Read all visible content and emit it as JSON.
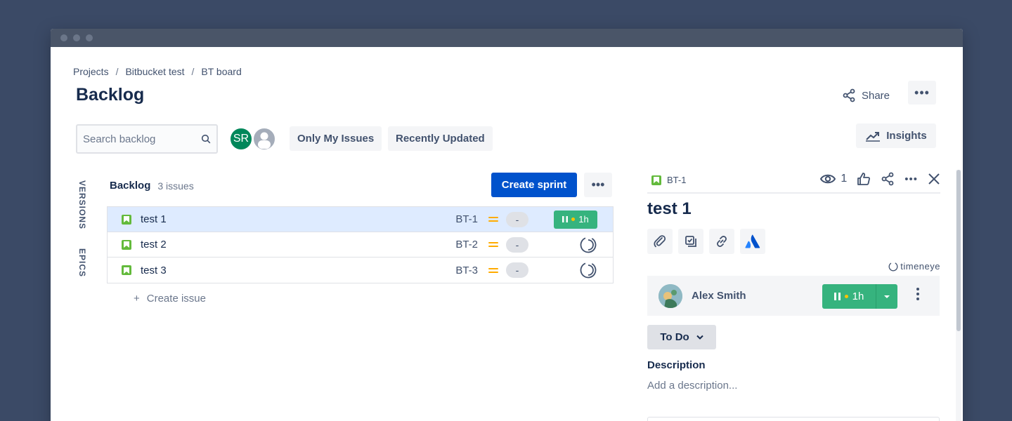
{
  "breadcrumb": {
    "projects": "Projects",
    "project": "Bitbucket test",
    "board": "BT board",
    "sep": "/"
  },
  "page": {
    "title": "Backlog",
    "share_label": "Share",
    "more": "•••"
  },
  "filters": {
    "search_placeholder": "Search backlog",
    "avatar_initials": "SR",
    "only_my_issues": "Only My Issues",
    "recently_updated": "Recently Updated",
    "insights": "Insights"
  },
  "side_tabs": {
    "versions": "VERSIONS",
    "epics": "EPICS"
  },
  "backlog": {
    "title": "Backlog",
    "count": "3 issues",
    "create_sprint": "Create sprint",
    "more": "•••",
    "create_issue": "Create issue",
    "plus": "+",
    "issues": [
      {
        "summary": "test 1",
        "key": "BT-1",
        "estimate": "-",
        "timer": "1h"
      },
      {
        "summary": "test 2",
        "key": "BT-2",
        "estimate": "-"
      },
      {
        "summary": "test 3",
        "key": "BT-3",
        "estimate": "-"
      }
    ]
  },
  "detail": {
    "key": "BT-1",
    "watchers": "1",
    "title": "test 1",
    "brand": "timeneye",
    "user_name": "Alex Smith",
    "timer": "1h",
    "status": "To Do",
    "description_label": "Description",
    "description_placeholder": "Add a description..."
  },
  "colors": {
    "primary": "#0052cc",
    "success": "#36b37e",
    "story": "#63ba3c",
    "priority_medium": "#ffab00",
    "avatar_sr": "#00875a"
  }
}
